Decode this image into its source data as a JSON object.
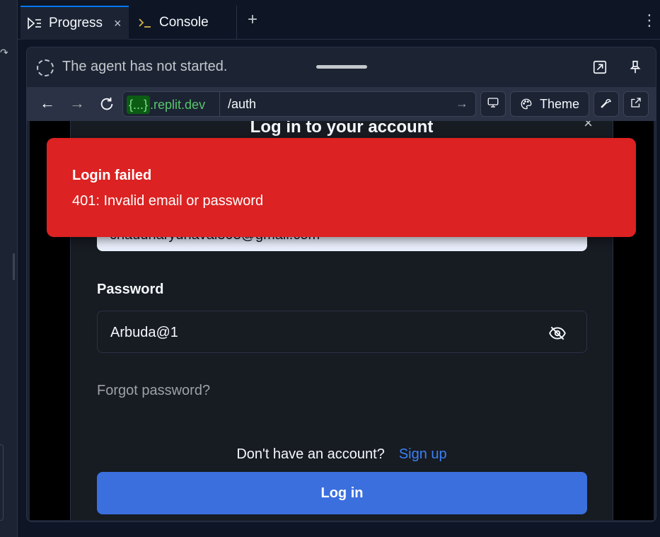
{
  "tabs": [
    {
      "label": "Progress",
      "icon": "progress-icon",
      "active": true
    },
    {
      "label": "Console",
      "icon": "terminal-icon",
      "active": false
    }
  ],
  "tab_close_glyph": "×",
  "add_tab_glyph": "+",
  "more_glyph": "⋮",
  "agent": {
    "status": "The agent has not started."
  },
  "browser": {
    "host_badge": "{...}",
    "host_suffix": ".replit.dev",
    "path": "/auth",
    "theme_label": "Theme"
  },
  "page": {
    "title": "Log in to your account",
    "close_glyph": "×",
    "email_value": "chaudharydhaval303@gmail.com",
    "password_label": "Password",
    "password_value": "Arbuda@1",
    "forgot_label": "Forgot password?",
    "no_account_text": "Don't have an account?",
    "signup_label": "Sign up",
    "login_label": "Log in"
  },
  "toast": {
    "title": "Login failed",
    "message": "401: Invalid email or password"
  },
  "colors": {
    "toast_bg": "#dc2222",
    "primary_button": "#3b6fde",
    "link": "#3b82f6",
    "host_green": "#58c56b",
    "active_tab_accent": "#0079f2"
  }
}
